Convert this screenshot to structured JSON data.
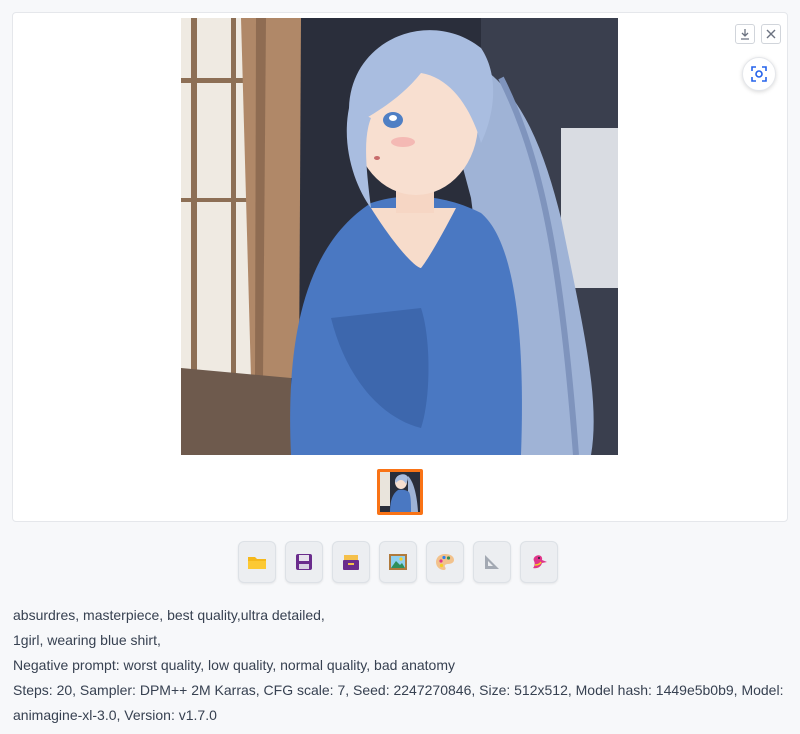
{
  "gallery": {
    "image_alt": "generated image: anime girl with long light-blue ponytail in a blue shirt beside a window",
    "download_icon": "download-icon",
    "close_icon": "close-icon",
    "fullscreen_icon": "fullscreen-icon",
    "thumbnail_selected_color": "#f97316"
  },
  "toolbar": {
    "buttons": [
      {
        "name": "open-folder-button",
        "icon": "folder-icon",
        "color": "#f5b81b"
      },
      {
        "name": "save-button",
        "icon": "floppy-disk-icon",
        "color": "#7b3fa0"
      },
      {
        "name": "zip-button",
        "icon": "card-file-box-icon",
        "color": "#6a2c8c"
      },
      {
        "name": "send-to-img2img-button",
        "icon": "framed-picture-icon",
        "color": "#2f8f5b"
      },
      {
        "name": "send-to-inpaint-button",
        "icon": "artist-palette-icon",
        "color": "#e08a3c"
      },
      {
        "name": "send-to-extras-button",
        "icon": "triangular-ruler-icon",
        "color": "#8a8f99"
      },
      {
        "name": "extra-tool-button",
        "icon": "bird-icon",
        "color": "#e0358a"
      }
    ]
  },
  "generation_info": {
    "line1": "absurdres, masterpiece, best quality,ultra detailed,",
    "line2": "1girl, wearing blue shirt,",
    "line3": "Negative prompt: worst quality, low quality, normal quality, bad anatomy",
    "line4": "Steps: 20, Sampler: DPM++ 2M Karras, CFG scale: 7, Seed: 2247270846, Size: 512x512, Model hash: 1449e5b0b9, Model:",
    "line5": "animagine-xl-3.0, Version: v1.7.0"
  }
}
